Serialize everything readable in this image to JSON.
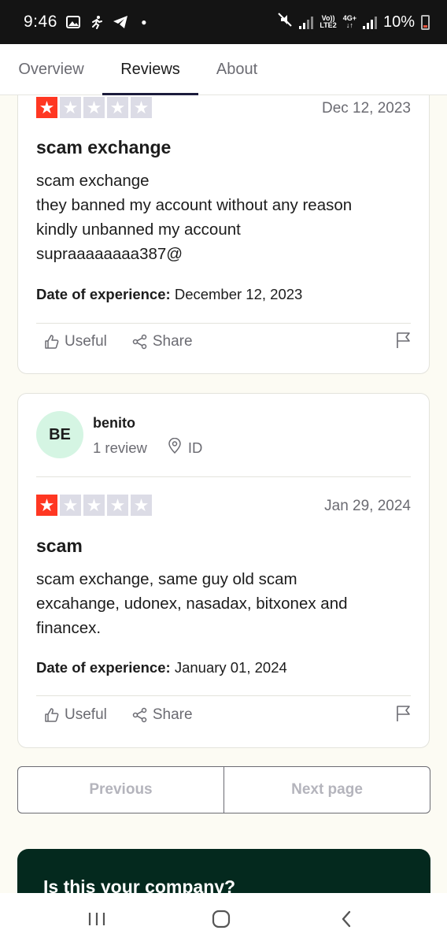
{
  "status_bar": {
    "time": "9:46",
    "battery": "10%",
    "network_top": "Vo))",
    "network_bottom": "LTE2",
    "network2_top": "4G+",
    "network2_bottom": "↓↑"
  },
  "tabs": [
    {
      "label": "Overview"
    },
    {
      "label": "Reviews"
    },
    {
      "label": "About"
    }
  ],
  "review1": {
    "stars": 1,
    "date": "Dec 12, 2023",
    "title": "scam exchange",
    "body": [
      "scam exchange",
      "they banned my account without any reason",
      "kindly unbanned my account",
      "supraaaaaaaa387@"
    ],
    "experience_label": "Date of experience:",
    "experience_date": "December 12, 2023",
    "useful_label": "Useful",
    "share_label": "Share"
  },
  "review2": {
    "avatar": "BE",
    "author": "benito",
    "review_count": "1 review",
    "location": "ID",
    "stars": 1,
    "date": "Jan 29, 2024",
    "title": "scam",
    "body": [
      "scam exchange, same guy old scam",
      "excahange, udonex, nasadax, bitxonex and",
      "financex."
    ],
    "experience_label": "Date of experience:",
    "experience_date": "January 01, 2024",
    "useful_label": "Useful",
    "share_label": "Share"
  },
  "pagination": {
    "previous_label": "Previous",
    "next_label": "Next page"
  },
  "company_banner": {
    "text": "Is this your company?"
  },
  "colors": {
    "star_active": "#ff3722",
    "star_inactive": "#dcdce6",
    "banner_bg": "#04291e",
    "avatar_bg": "#d5f5e3"
  }
}
